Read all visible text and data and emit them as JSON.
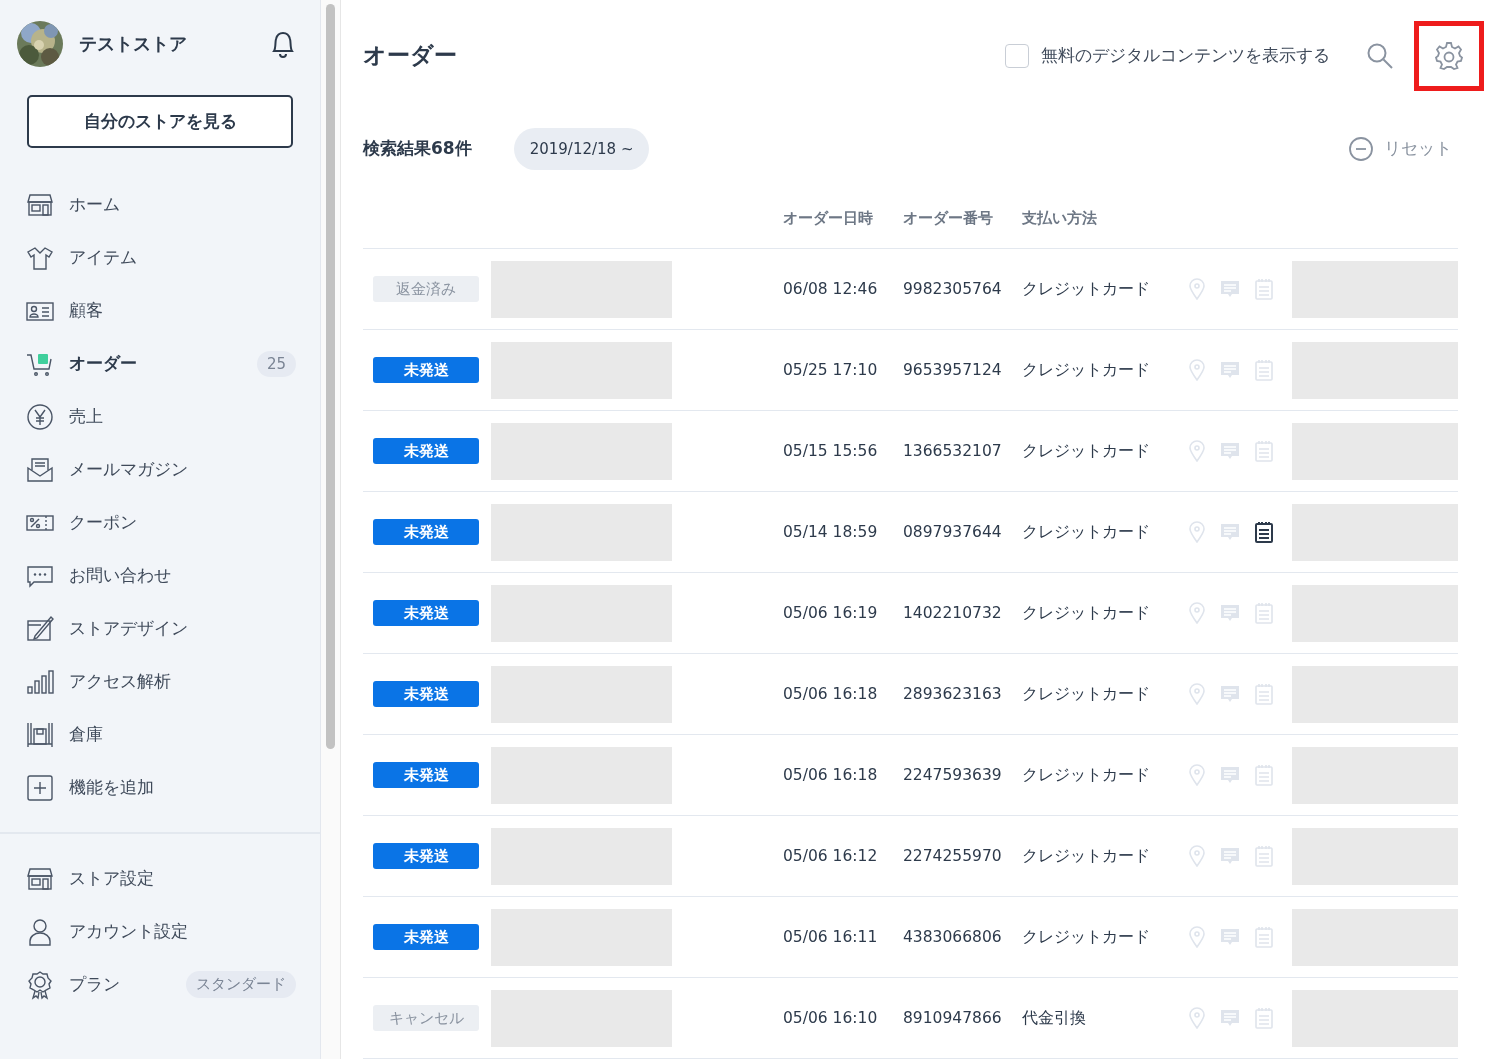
{
  "sidebar": {
    "store_name": "テストストア",
    "view_store_button": "自分のストアを見る",
    "items": [
      {
        "kind": "store",
        "label": "ホーム",
        "selected": false
      },
      {
        "kind": "shirt",
        "label": "アイテム",
        "selected": false
      },
      {
        "kind": "card",
        "label": "顧客",
        "selected": false
      },
      {
        "kind": "cart",
        "label": "オーダー",
        "selected": true,
        "badge": "25"
      },
      {
        "kind": "yen",
        "label": "売上",
        "selected": false
      },
      {
        "kind": "mail",
        "label": "メールマガジン",
        "selected": false
      },
      {
        "kind": "coupon",
        "label": "クーポン",
        "selected": false
      },
      {
        "kind": "chat",
        "label": "お問い合わせ",
        "selected": false
      },
      {
        "kind": "design",
        "label": "ストアデザイン",
        "selected": false
      },
      {
        "kind": "bars",
        "label": "アクセス解析",
        "selected": false
      },
      {
        "kind": "warehouse",
        "label": "倉庫",
        "selected": false
      },
      {
        "kind": "plus",
        "label": "機能を追加",
        "selected": false
      }
    ],
    "bottom_items": [
      {
        "kind": "store",
        "label": "ストア設定",
        "selected": false
      },
      {
        "kind": "person",
        "label": "アカウント設定",
        "selected": false
      },
      {
        "kind": "award",
        "label": "プラン",
        "selected": false,
        "badge": "スタンダード"
      }
    ]
  },
  "header": {
    "title": "オーダー",
    "free_digital_checkbox": {
      "label": "無料のデジタルコンテンツを表示する",
      "checked": false
    },
    "settings_highlighted": true
  },
  "filter": {
    "result_count": "検索結果68件",
    "date_chip": "2019/12/18 ~",
    "reset": "リセット"
  },
  "table": {
    "columns": [
      "オーダー日時",
      "オーダー番号",
      "支払い方法"
    ],
    "rows": [
      {
        "status": "返金済み",
        "kind": "refunded",
        "date": "06/08 12:46",
        "number": "9982305764",
        "payment": "クレジットカード",
        "memo": false
      },
      {
        "status": "未発送",
        "kind": "unshipped",
        "date": "05/25 17:10",
        "number": "9653957124",
        "payment": "クレジットカード",
        "memo": false
      },
      {
        "status": "未発送",
        "kind": "unshipped",
        "date": "05/15 15:56",
        "number": "1366532107",
        "payment": "クレジットカード",
        "memo": false
      },
      {
        "status": "未発送",
        "kind": "unshipped",
        "date": "05/14 18:59",
        "number": "0897937644",
        "payment": "クレジットカード",
        "memo": true
      },
      {
        "status": "未発送",
        "kind": "unshipped",
        "date": "05/06 16:19",
        "number": "1402210732",
        "payment": "クレジットカード",
        "memo": false
      },
      {
        "status": "未発送",
        "kind": "unshipped",
        "date": "05/06 16:18",
        "number": "2893623163",
        "payment": "クレジットカード",
        "memo": false
      },
      {
        "status": "未発送",
        "kind": "unshipped",
        "date": "05/06 16:18",
        "number": "2247593639",
        "payment": "クレジットカード",
        "memo": false
      },
      {
        "status": "未発送",
        "kind": "unshipped",
        "date": "05/06 16:12",
        "number": "2274255970",
        "payment": "クレジットカード",
        "memo": false
      },
      {
        "status": "未発送",
        "kind": "unshipped",
        "date": "05/06 16:11",
        "number": "4383066806",
        "payment": "クレジットカード",
        "memo": false
      },
      {
        "status": "キャンセル",
        "kind": "cancelled",
        "date": "05/06 16:10",
        "number": "8910947866",
        "payment": "代金引換",
        "memo": false
      }
    ]
  }
}
